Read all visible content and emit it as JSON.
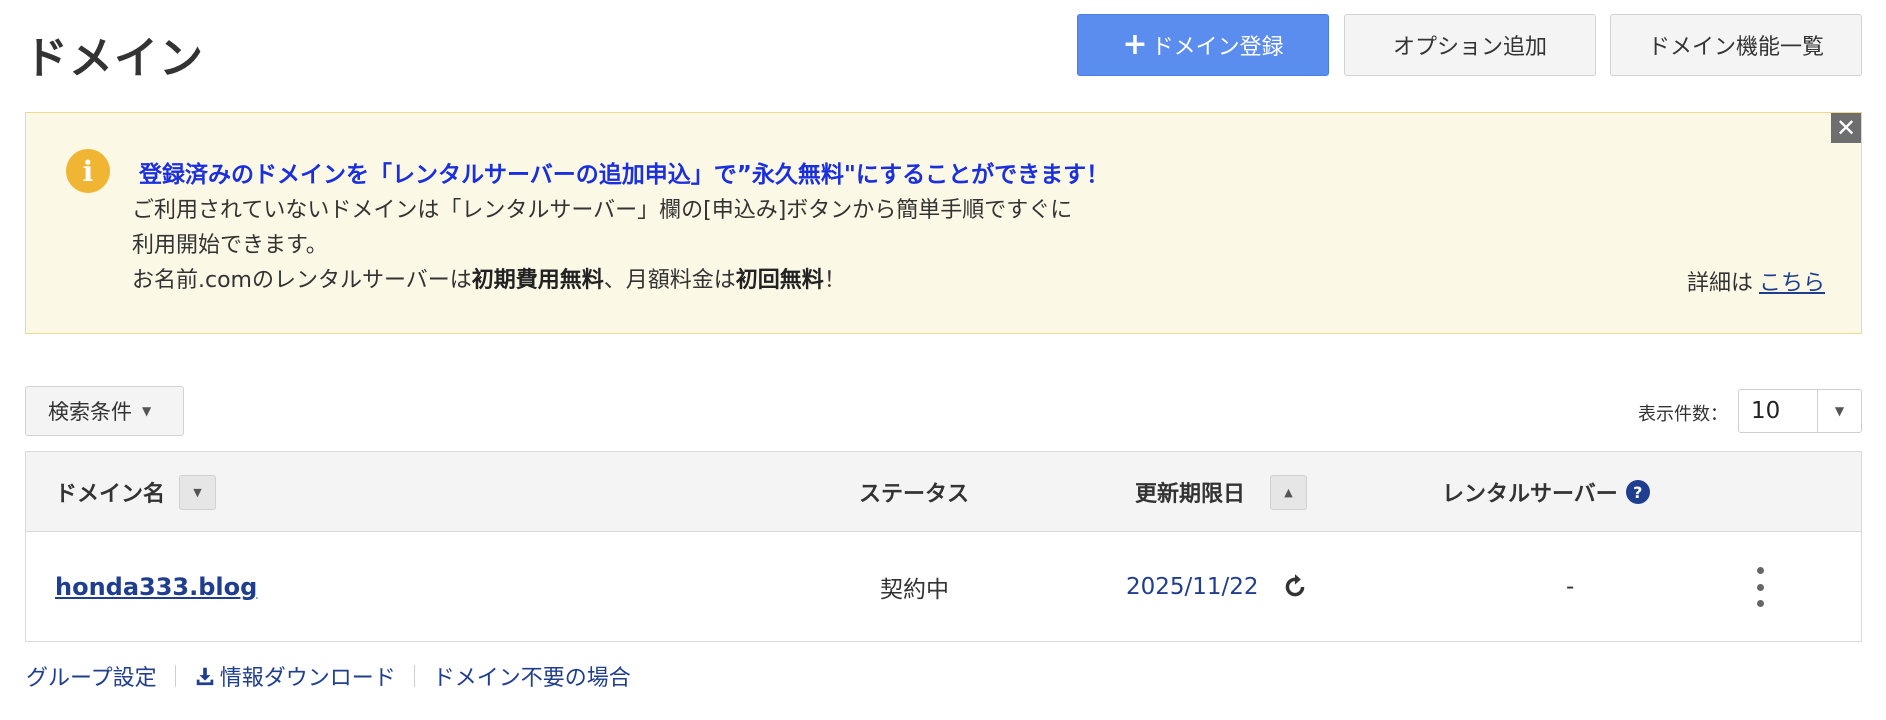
{
  "page": {
    "title": "ドメイン"
  },
  "header": {
    "register_plus": "+",
    "register_label": "ドメイン登録",
    "option_label": "オプション追加",
    "features_label": "ドメイン機能一覧"
  },
  "notice": {
    "close_glyph": "✕",
    "icon_glyph": "i",
    "heading": "登録済みのドメインを「レンタルサーバーの追加申込」で”永久無料\"にすることができます！",
    "line1": "ご利用されていないドメインは「レンタルサーバー」欄の[申込み]ボタンから簡単手順ですぐに",
    "line2": "利用開始できます。",
    "line3_a": "お名前.comのレンタルサーバーは",
    "line3_b": "初期費用無料",
    "line3_c": "、月額料金は",
    "line3_d": "初回無料",
    "line3_e": "！",
    "detail_prefix": "詳細は",
    "detail_link": "こちら"
  },
  "filters": {
    "search_label": "検索条件",
    "per_page_label": "表示件数：",
    "per_page_value": "10"
  },
  "table": {
    "columns": {
      "domain": "ドメイン名",
      "status": "ステータス",
      "renewal": "更新期限日",
      "server": "レンタルサーバー",
      "help_glyph": "?"
    },
    "rows": [
      {
        "domain": "honda333.blog",
        "status": "契約中",
        "renewal": "2025/11/22",
        "server": "-"
      }
    ]
  },
  "footer": {
    "group_settings": "グループ設定",
    "download": "情報ダウンロード",
    "not_needed": "ドメイン不要の場合"
  },
  "colors": {
    "primary": "#5b8def",
    "link": "#1f3e8f",
    "notice_bg": "#fcf8e6",
    "notice_heading": "#1a2fe0",
    "info_icon": "#f0b532"
  }
}
